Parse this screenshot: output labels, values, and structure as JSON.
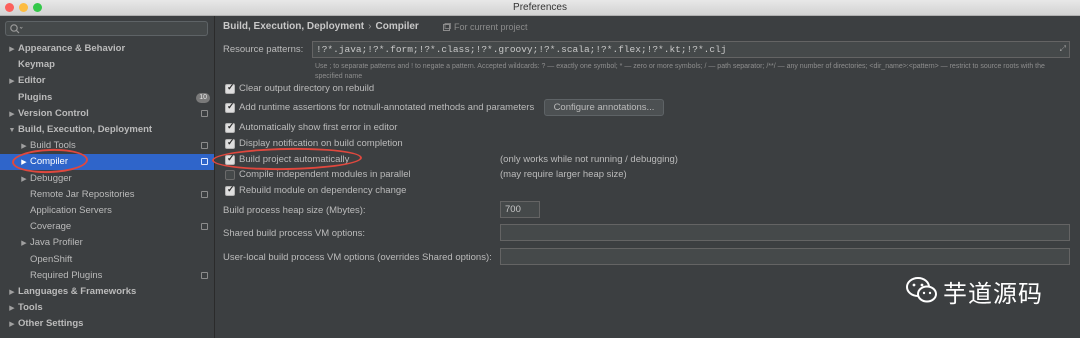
{
  "window": {
    "title": "Preferences"
  },
  "colors": {
    "close": "#fc605c",
    "minimize": "#fdbc40",
    "maximize": "#34c84a",
    "selection": "#2f65ca",
    "annotation": "#e0483e"
  },
  "search": {
    "icon": "search-icon",
    "placeholder": ""
  },
  "sidebar": {
    "items": [
      {
        "label": "Appearance & Behavior",
        "arrow": "▶",
        "indent": 0,
        "bold": true,
        "copy": false
      },
      {
        "label": "Keymap",
        "arrow": "",
        "indent": 0,
        "bold": true,
        "copy": false
      },
      {
        "label": "Editor",
        "arrow": "▶",
        "indent": 0,
        "bold": true,
        "copy": false
      },
      {
        "label": "Plugins",
        "arrow": "",
        "indent": 0,
        "bold": true,
        "copy": false,
        "badge": "10"
      },
      {
        "label": "Version Control",
        "arrow": "▶",
        "indent": 0,
        "bold": true,
        "copy": true
      },
      {
        "label": "Build, Execution, Deployment",
        "arrow": "▼",
        "indent": 0,
        "bold": true,
        "copy": false
      },
      {
        "label": "Build Tools",
        "arrow": "▶",
        "indent": 1,
        "bold": false,
        "copy": true
      },
      {
        "label": "Compiler",
        "arrow": "▶",
        "indent": 1,
        "bold": false,
        "copy": true,
        "selected": true
      },
      {
        "label": "Debugger",
        "arrow": "▶",
        "indent": 1,
        "bold": false,
        "copy": false
      },
      {
        "label": "Remote Jar Repositories",
        "arrow": "",
        "indent": 1,
        "bold": false,
        "copy": true
      },
      {
        "label": "Application Servers",
        "arrow": "",
        "indent": 1,
        "bold": false,
        "copy": false
      },
      {
        "label": "Coverage",
        "arrow": "",
        "indent": 1,
        "bold": false,
        "copy": true
      },
      {
        "label": "Java Profiler",
        "arrow": "▶",
        "indent": 1,
        "bold": false,
        "copy": false
      },
      {
        "label": "OpenShift",
        "arrow": "",
        "indent": 1,
        "bold": false,
        "copy": false
      },
      {
        "label": "Required Plugins",
        "arrow": "",
        "indent": 1,
        "bold": false,
        "copy": true
      },
      {
        "label": "Languages & Frameworks",
        "arrow": "▶",
        "indent": 0,
        "bold": true,
        "copy": false
      },
      {
        "label": "Tools",
        "arrow": "▶",
        "indent": 0,
        "bold": true,
        "copy": false
      },
      {
        "label": "Other Settings",
        "arrow": "▶",
        "indent": 0,
        "bold": true,
        "copy": false
      }
    ]
  },
  "main": {
    "breadcrumb": {
      "parent": "Build, Execution, Deployment",
      "separator": "›",
      "current": "Compiler"
    },
    "for_current_project": "For current project",
    "resource_patterns": {
      "label": "Resource patterns:",
      "value": "!?*.java;!?*.form;!?*.class;!?*.groovy;!?*.scala;!?*.flex;!?*.kt;!?*.clj",
      "hint": "Use ; to separate patterns and ! to negate a pattern. Accepted wildcards: ? — exactly one symbol; * — zero or more symbols; / — path separator; /**/ — any number of directories; <dir_name>:<pattern> — restrict to source roots with the specified name"
    },
    "options": [
      {
        "label": "Clear output directory on rebuild",
        "checked": true,
        "note": ""
      },
      {
        "label": "Add runtime assertions for notnull-annotated methods and parameters",
        "checked": true,
        "note": ""
      },
      {
        "label": "Automatically show first error in editor",
        "checked": true,
        "note": ""
      },
      {
        "label": "Display notification on build completion",
        "checked": true,
        "note": ""
      },
      {
        "label": "Build project automatically",
        "checked": true,
        "note": "(only works while not running / debugging)"
      },
      {
        "label": "Compile independent modules in parallel",
        "checked": false,
        "note": "(may require larger heap size)"
      },
      {
        "label": "Rebuild module on dependency change",
        "checked": true,
        "note": ""
      }
    ],
    "configure_button": "Configure annotations...",
    "heap_size": {
      "label": "Build process heap size (Mbytes):",
      "value": "700"
    },
    "shared_vm": {
      "label": "Shared build process VM options:",
      "value": ""
    },
    "user_vm": {
      "label": "User-local build process VM options (overrides Shared options):",
      "value": ""
    }
  },
  "watermark": {
    "text": "芋道源码",
    "icon": "wechat-icon"
  }
}
